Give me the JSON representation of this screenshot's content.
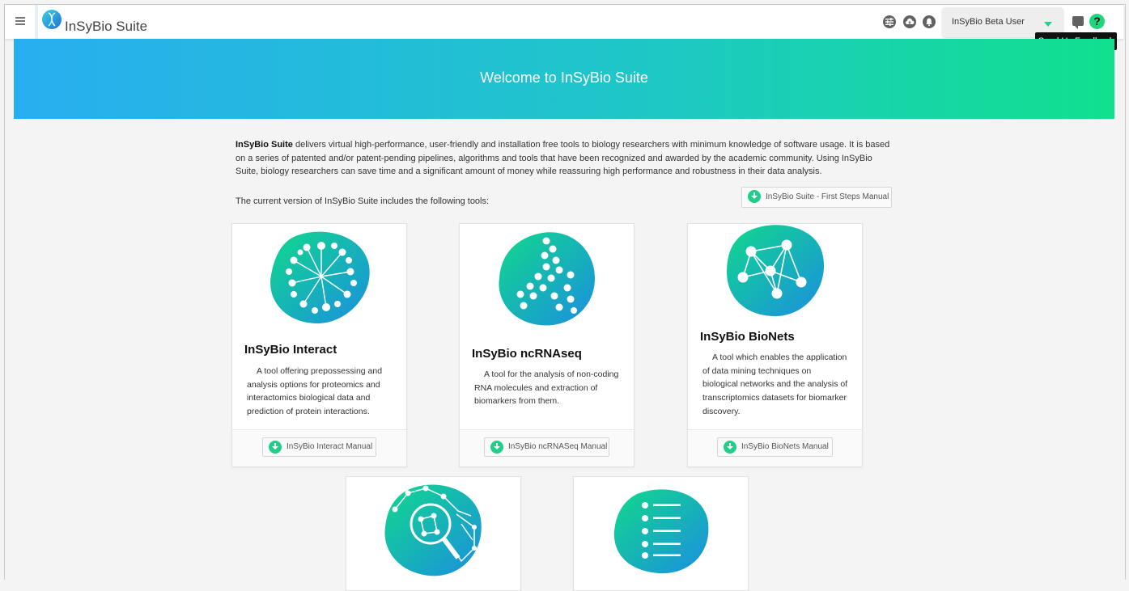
{
  "header": {
    "app_title": "InSyBio Suite",
    "user_select": "InSyBio Beta User",
    "tooltip": "Send Us Feedback",
    "help_glyph": "?"
  },
  "banner": {
    "title": "Welcome to InSyBio Suite"
  },
  "intro": {
    "brand": "InSyBio Suite",
    "text": " delivers virtual high-performance, user-friendly and installation free tools to biology researchers with minimum knowledge of software usage. It is based on a series of patented and/or patent-pending pipelines, algorithms and tools that have been recognized and awarded by the academic community. Using InSyBio Suite, biology researchers can save time and a significant amount of money while reassuring high performance and robustness in their data analysis.",
    "tools_lead": "The current version of InSyBio Suite includes the following tools:",
    "manual_button": "InSyBio Suite - First Steps Manual"
  },
  "cards": [
    {
      "title": "InSyBio Interact",
      "description": "A tool offering prepossessing and analysis options for proteomics and interactomics biological data and prediction of protein interactions.",
      "button": "InSyBio Interact Manual"
    },
    {
      "title": "InSyBio ncRNAseq",
      "description": "A tool for the analysis of non-coding RNA molecules and extraction of biomarkers from them.",
      "button": "InSyBio ncRNASeq Manual"
    },
    {
      "title": "InSyBio BioNets",
      "description": "A tool which enables the application of data mining techniques on biological networks and the analysis of transcriptomics datasets for biomarker discovery.",
      "button": "InSyBio BioNets Manual"
    }
  ],
  "icons": [
    "menu-icon",
    "logo-icon",
    "sliders-icon",
    "cloud-icon",
    "bell-icon",
    "feedback-icon",
    "help-icon",
    "download-icon"
  ],
  "colors": {
    "accent": "#1fcf86",
    "banner_start": "#28aef0",
    "banner_end": "#10e08e"
  }
}
